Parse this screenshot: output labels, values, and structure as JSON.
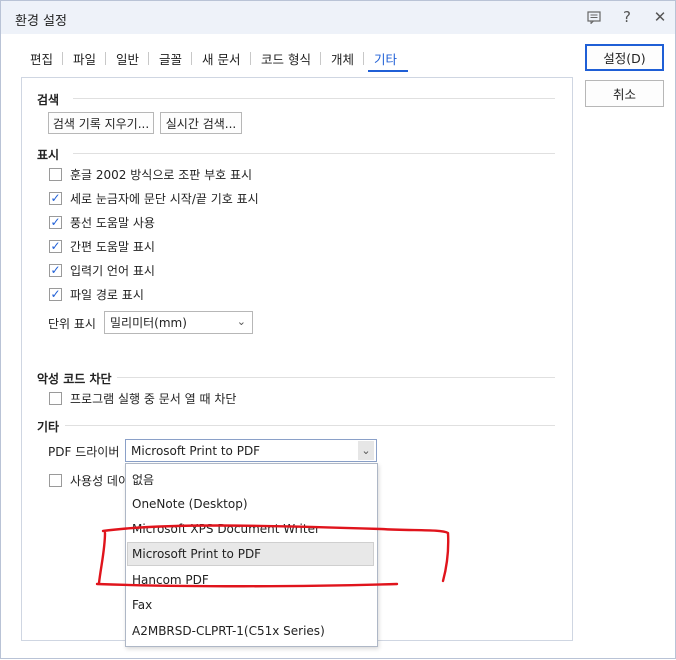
{
  "window": {
    "title": "환경 설정"
  },
  "titlebar_icons": [
    "comment-icon",
    "help-icon",
    "close-icon"
  ],
  "tabs": [
    {
      "label": "편집"
    },
    {
      "label": "파일"
    },
    {
      "label": "일반"
    },
    {
      "label": "글꼴"
    },
    {
      "label": "새 문서"
    },
    {
      "label": "코드 형식"
    },
    {
      "label": "개체"
    },
    {
      "label": "기타"
    }
  ],
  "active_tab": "기타",
  "search": {
    "heading": "검색",
    "clear_history_label": "검색 기록 지우기...",
    "realtime_search_label": "실시간 검색..."
  },
  "display": {
    "heading": "표시",
    "options": [
      {
        "label": "훈글 2002 방식으로 조판 부호 표시",
        "checked": false
      },
      {
        "label": "세로 눈금자에 문단 시작/끝 기호 표시",
        "checked": true
      },
      {
        "label": "풍선 도움말 사용",
        "checked": true
      },
      {
        "label": "간편 도움말 표시",
        "checked": true
      },
      {
        "label": "입력기 언어 표시",
        "checked": true
      },
      {
        "label": "파일 경로 표시",
        "checked": true
      }
    ],
    "unit_label": "단위 표시",
    "unit_value": "밀리미터(mm)"
  },
  "malicious": {
    "heading": "악성 코드 차단",
    "option_label": "프로그램 실행 중 문서 열 때 차단",
    "checked": false
  },
  "other": {
    "heading": "기타",
    "pdf_driver_label": "PDF 드라이버",
    "pdf_driver_value": "Microsoft Print to PDF",
    "usage_label": "사용성 데이"
  },
  "dropdown_options": [
    "없음",
    "OneNote (Desktop)",
    "Microsoft XPS Document Writer",
    "Microsoft Print to PDF",
    "Hancom PDF",
    "Fax",
    "A2MBRSD-CLPRT-1(C51x Series)"
  ],
  "dropdown_selected": "Microsoft Print to PDF",
  "buttons": {
    "ok_label": "설정(D)",
    "cancel_label": "취소"
  },
  "colors": {
    "accent": "#1f5fd6",
    "annotation": "#e0141c"
  }
}
